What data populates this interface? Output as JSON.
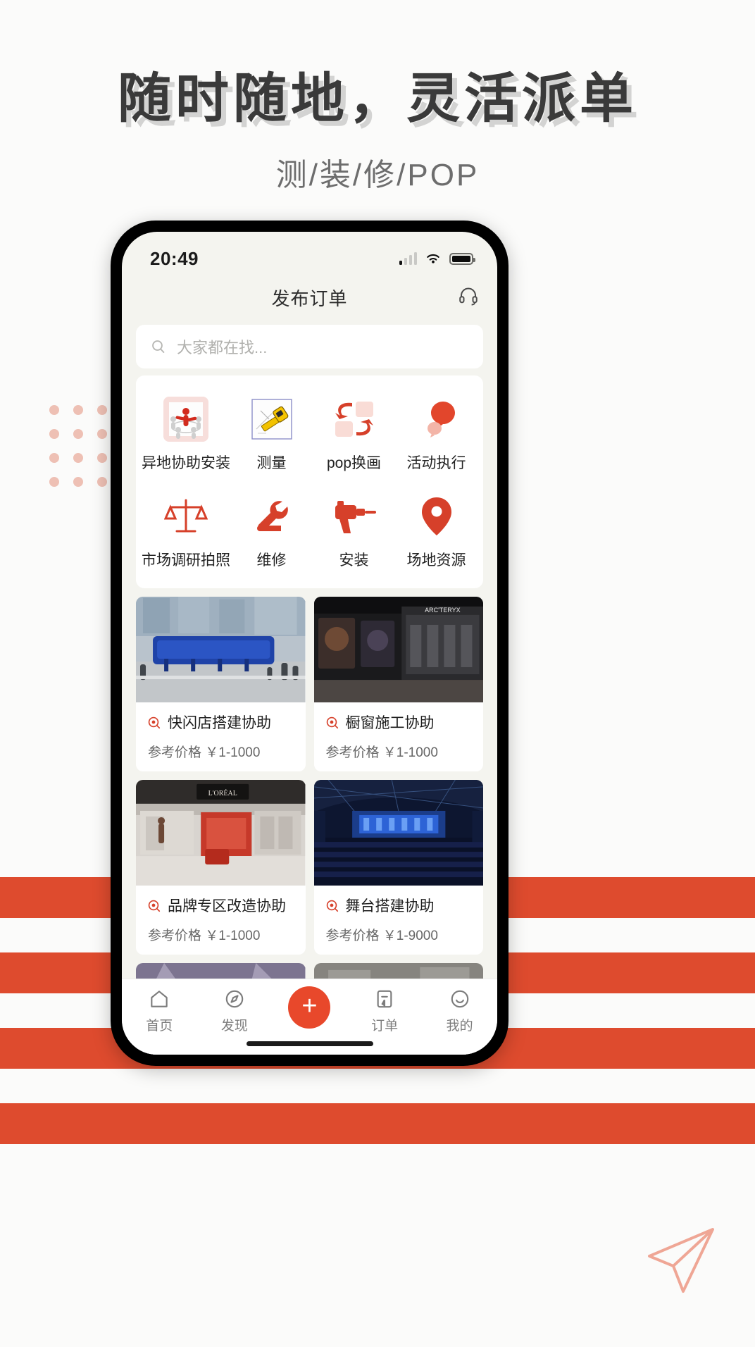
{
  "promo": {
    "headline": "随时随地，灵活派单",
    "subhead": "测/装/修/POP",
    "accent_color": "#de4b2e",
    "headline_color": "#3a3a3a"
  },
  "status_bar": {
    "time": "20:49",
    "signal_icon": "signal-bars-icon",
    "wifi_icon": "wifi-icon",
    "battery_icon": "battery-full-icon"
  },
  "app": {
    "title": "发布订单",
    "support_icon": "headset-icon"
  },
  "search": {
    "placeholder": "大家都在找...",
    "value": "",
    "icon": "search-icon"
  },
  "categories": [
    {
      "label": "异地协助安装",
      "icon": "people-circle-icon"
    },
    {
      "label": "测量",
      "icon": "tape-measure-icon"
    },
    {
      "label": "pop换画",
      "icon": "swap-arrows-icon"
    },
    {
      "label": "活动执行",
      "icon": "balloon-icon"
    },
    {
      "label": "市场调研拍照",
      "icon": "scales-icon"
    },
    {
      "label": "维修",
      "icon": "wrench-icon"
    },
    {
      "label": "安装",
      "icon": "drill-icon"
    },
    {
      "label": "场地资源",
      "icon": "location-pin-icon"
    }
  ],
  "cards": [
    {
      "title": "快闪店搭建协助",
      "price": "参考价格  ￥1-1000",
      "icon": "target-icon",
      "img": "popup-store-street-photo"
    },
    {
      "title": "橱窗施工协助",
      "price": "参考价格  ￥1-1000",
      "icon": "target-icon",
      "img": "mall-storefront-photo"
    },
    {
      "title": "品牌专区改造协助",
      "price": "参考价格  ￥1-1000",
      "icon": "target-icon",
      "img": "brand-counter-photo"
    },
    {
      "title": "舞台搭建协助",
      "price": "参考价格  ￥1-9000",
      "icon": "target-icon",
      "img": "stage-arena-photo"
    }
  ],
  "tabbar": [
    {
      "label": "首页",
      "icon": "home-icon"
    },
    {
      "label": "发现",
      "icon": "compass-icon"
    },
    {
      "label": "",
      "icon": "plus-icon"
    },
    {
      "label": "订单",
      "icon": "order-bookmark-icon"
    },
    {
      "label": "我的",
      "icon": "profile-icon"
    }
  ]
}
